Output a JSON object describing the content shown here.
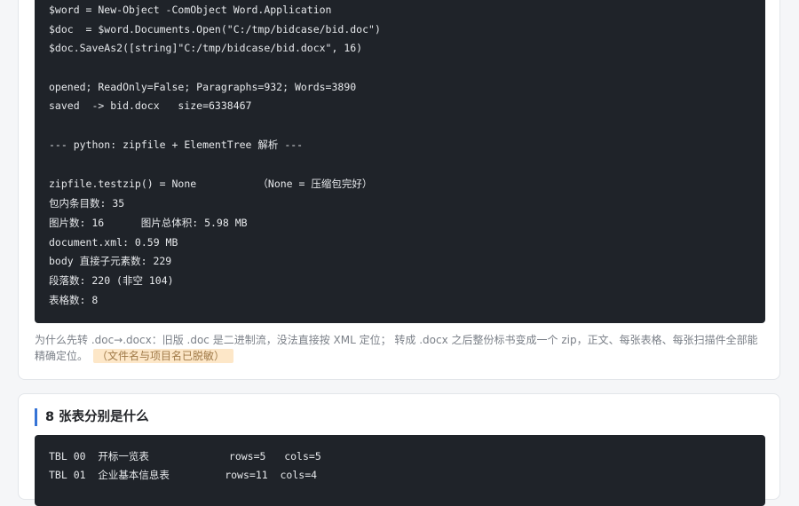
{
  "card1": {
    "code_lines": [
      "$word = New-Object -ComObject Word.Application",
      "$doc  = $word.Documents.Open(\"C:/tmp/bidcase/bid.doc\")",
      "$doc.SaveAs2([string]\"C:/tmp/bidcase/bid.docx\", 16)",
      "",
      "opened; ReadOnly=False; Paragraphs=932; Words=3890",
      "saved  -> bid.docx   size=6338467",
      "",
      "--- python: zipfile + ElementTree 解析 ---",
      "",
      "zipfile.testzip() = None          （None = 压缩包完好）",
      "包内条目数: 35",
      "图片数: 16      图片总体积: 5.98 MB",
      "document.xml: 0.59 MB",
      "body 直接子元素数: 229",
      "段落数: 220 (非空 104)",
      "表格数: 8"
    ],
    "note_text": "为什么先转 .doc→.docx：旧版 .doc 是二进制流，没法直接按 XML 定位； 转成 .docx 之后整份标书变成一个 zip，正文、每张表格、每张扫描件全部能精确定位。",
    "note_tag": "（文件名与项目名已脱敏）"
  },
  "card2": {
    "title": "8 张表分别是什么",
    "code_lines": [
      "TBL 00  开标一览表             rows=5   cols=5",
      "TBL 01  企业基本信息表         rows=11  cols=4"
    ]
  },
  "colors": {
    "page_bg": "#f5f6f8",
    "code_bg": "#1f2329",
    "accent": "#3573d6",
    "tag_bg": "#fde7c8"
  }
}
